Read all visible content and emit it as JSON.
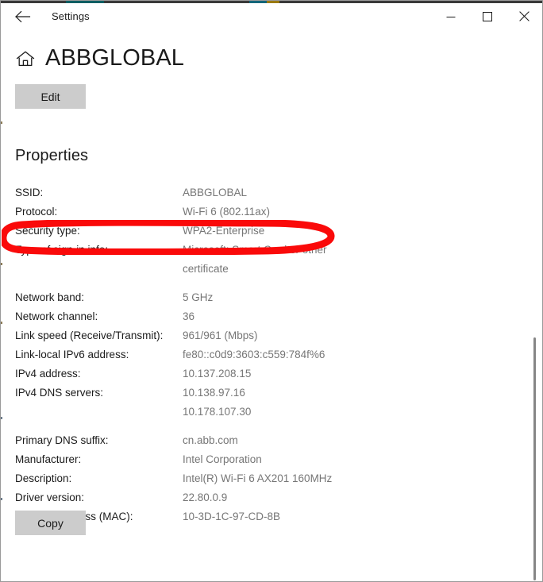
{
  "window": {
    "titlebar": {
      "back_label": "Back",
      "title": "Settings",
      "minimize_label": "Minimize",
      "maximize_label": "Maximize",
      "close_label": "Close"
    }
  },
  "header": {
    "home_icon": "home-icon",
    "title": "ABBGLOBAL",
    "edit_button": "Edit"
  },
  "properties": {
    "heading": "Properties",
    "rows": [
      {
        "label": "SSID:",
        "value": "ABBGLOBAL",
        "gap": false
      },
      {
        "label": "Protocol:",
        "value": "Wi-Fi 6 (802.11ax)",
        "gap": false
      },
      {
        "label": "Security type:",
        "value": "WPA2-Enterprise",
        "gap": false
      },
      {
        "label": "Type of sign-in info:",
        "value": "Microsoft: Smart Card or other\ncertificate",
        "gap": false
      },
      {
        "label": "Network band:",
        "value": "5 GHz",
        "gap": true
      },
      {
        "label": "Network channel:",
        "value": "36",
        "gap": false
      },
      {
        "label": "Link speed (Receive/Transmit):",
        "value": "961/961 (Mbps)",
        "gap": false
      },
      {
        "label": "Link-local IPv6 address:",
        "value": "fe80::c0d9:3603:c559:784f%6",
        "gap": false
      },
      {
        "label": "IPv4 address:",
        "value": "10.137.208.15",
        "gap": false
      },
      {
        "label": "IPv4 DNS servers:",
        "value": "10.138.97.16\n10.178.107.30",
        "gap": false
      },
      {
        "label": "Primary DNS suffix:",
        "value": "cn.abb.com",
        "gap": true
      },
      {
        "label": "Manufacturer:",
        "value": "Intel Corporation",
        "gap": false
      },
      {
        "label": "Description:",
        "value": "Intel(R) Wi-Fi 6 AX201 160MHz",
        "gap": false
      },
      {
        "label": "Driver version:",
        "value": "22.80.0.9",
        "gap": false
      },
      {
        "label": "Physical address (MAC):",
        "value": "10-3D-1C-97-CD-8B",
        "gap": false
      }
    ]
  },
  "footer": {
    "copy_button": "Copy"
  },
  "annotation": {
    "shape": "ellipse-highlight",
    "target": "Protocol:",
    "color": "#FA0A0A"
  },
  "colors": {
    "label_text": "#1b1b1b",
    "value_text": "#767676",
    "button_fill": "#cccccc",
    "annotation_red": "#FA0A0A",
    "scrollbar": "#868686",
    "window_border": "#9a9a9a"
  }
}
